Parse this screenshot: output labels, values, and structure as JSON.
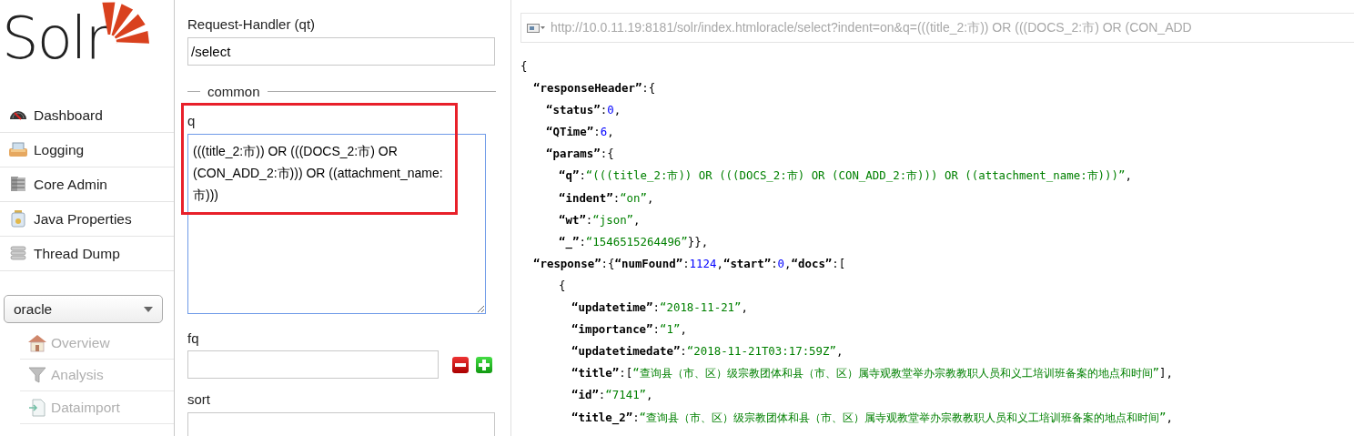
{
  "logo": {
    "text": "Solr"
  },
  "nav": [
    {
      "label": "Dashboard"
    },
    {
      "label": "Logging"
    },
    {
      "label": "Core Admin"
    },
    {
      "label": "Java Properties"
    },
    {
      "label": "Thread Dump"
    }
  ],
  "core_selector": {
    "value": "oracle"
  },
  "core_menu": [
    {
      "label": "Overview",
      "disabled": true
    },
    {
      "label": "Analysis",
      "disabled": true
    },
    {
      "label": "Dataimport",
      "disabled": true
    }
  ],
  "query_form": {
    "handler_label": "Request-Handler (qt)",
    "handler_value": "/select",
    "section": "common",
    "q_label": "q",
    "q_value": "(((title_2:市)) OR (((DOCS_2:市) OR (CON_ADD_2:市))) OR ((attachment_name:市)))",
    "q_focused": true,
    "fq_label": "fq",
    "sort_label": "sort"
  },
  "url_bar": {
    "text": "http://10.0.11.19:8181/solr/index.htmloracle/select?indent=on&q=(((title_2:市)) OR (((DOCS_2:市) OR (CON_ADD"
  },
  "response": [
    {
      "tokens": [
        {
          "kind": "punct",
          "text": "{"
        }
      ],
      "children": [
        {
          "tokens": [
            {
              "kind": "key",
              "text": "“responseHeader”"
            },
            {
              "kind": "punct",
              "text": ":{"
            }
          ],
          "children": [
            {
              "tokens": [
                {
                  "kind": "key",
                  "text": "“status”"
                },
                {
                  "kind": "punct",
                  "text": ":"
                },
                {
                  "kind": "num",
                  "text": "0"
                },
                {
                  "kind": "punct",
                  "text": ","
                }
              ]
            },
            {
              "tokens": [
                {
                  "kind": "key",
                  "text": "“QTime”"
                },
                {
                  "kind": "punct",
                  "text": ":"
                },
                {
                  "kind": "num",
                  "text": "6"
                },
                {
                  "kind": "punct",
                  "text": ","
                }
              ]
            },
            {
              "tokens": [
                {
                  "kind": "key",
                  "text": "“params”"
                },
                {
                  "kind": "punct",
                  "text": ":{"
                }
              ],
              "children": [
                {
                  "tokens": [
                    {
                      "kind": "key",
                      "text": "“q”"
                    },
                    {
                      "kind": "punct",
                      "text": ":"
                    },
                    {
                      "kind": "str",
                      "text": "“(((title_2:市)) OR (((DOCS_2:市) OR (CON_ADD_2:市))) OR ((attachment_name:市)))”"
                    },
                    {
                      "kind": "punct",
                      "text": ","
                    }
                  ]
                },
                {
                  "tokens": [
                    {
                      "kind": "key",
                      "text": "“indent”"
                    },
                    {
                      "kind": "punct",
                      "text": ":"
                    },
                    {
                      "kind": "str",
                      "text": "“on”"
                    },
                    {
                      "kind": "punct",
                      "text": ","
                    }
                  ]
                },
                {
                  "tokens": [
                    {
                      "kind": "key",
                      "text": "“wt”"
                    },
                    {
                      "kind": "punct",
                      "text": ":"
                    },
                    {
                      "kind": "str",
                      "text": "“json”"
                    },
                    {
                      "kind": "punct",
                      "text": ","
                    }
                  ]
                },
                {
                  "tokens": [
                    {
                      "kind": "key",
                      "text": "“_”"
                    },
                    {
                      "kind": "punct",
                      "text": ":"
                    },
                    {
                      "kind": "str",
                      "text": "“1546515264496”"
                    },
                    {
                      "kind": "punct",
                      "text": "}},"
                    }
                  ]
                }
              ]
            }
          ]
        },
        {
          "tokens": [
            {
              "kind": "key",
              "text": "“response”"
            },
            {
              "kind": "punct",
              "text": ":{"
            },
            {
              "kind": "key",
              "text": "“numFound”"
            },
            {
              "kind": "punct",
              "text": ":"
            },
            {
              "kind": "num",
              "text": "1124"
            },
            {
              "kind": "punct",
              "text": ","
            },
            {
              "kind": "key",
              "text": "“start”"
            },
            {
              "kind": "punct",
              "text": ":"
            },
            {
              "kind": "num",
              "text": "0"
            },
            {
              "kind": "punct",
              "text": ","
            },
            {
              "kind": "key",
              "text": "“docs”"
            },
            {
              "kind": "punct",
              "text": ":["
            }
          ],
          "children": [
            {
              "tokens": [
                {
                  "kind": "punct",
                  "text": "{"
                }
              ],
              "children": [
                {
                  "tokens": [
                    {
                      "kind": "key",
                      "text": "“updatetime”"
                    },
                    {
                      "kind": "punct",
                      "text": ":"
                    },
                    {
                      "kind": "str",
                      "text": "“2018-11-21”"
                    },
                    {
                      "kind": "punct",
                      "text": ","
                    }
                  ]
                },
                {
                  "tokens": [
                    {
                      "kind": "key",
                      "text": "“importance”"
                    },
                    {
                      "kind": "punct",
                      "text": ":"
                    },
                    {
                      "kind": "str",
                      "text": "“1”"
                    },
                    {
                      "kind": "punct",
                      "text": ","
                    }
                  ]
                },
                {
                  "tokens": [
                    {
                      "kind": "key",
                      "text": "“updatetimedate”"
                    },
                    {
                      "kind": "punct",
                      "text": ":"
                    },
                    {
                      "kind": "str",
                      "text": "“2018-11-21T03:17:59Z”"
                    },
                    {
                      "kind": "punct",
                      "text": ","
                    }
                  ]
                },
                {
                  "tokens": [
                    {
                      "kind": "key",
                      "text": "“title”"
                    },
                    {
                      "kind": "punct",
                      "text": ":["
                    },
                    {
                      "kind": "str",
                      "text": "“查询县（市、区）级宗教团体和县（市、区）属寺观教堂举办宗教教职人员和义工培训班备案的地点和时间”"
                    },
                    {
                      "kind": "punct",
                      "text": "],"
                    }
                  ]
                },
                {
                  "tokens": [
                    {
                      "kind": "key",
                      "text": "“id”"
                    },
                    {
                      "kind": "punct",
                      "text": ":"
                    },
                    {
                      "kind": "str",
                      "text": "“7141”"
                    },
                    {
                      "kind": "punct",
                      "text": ","
                    }
                  ]
                },
                {
                  "tokens": [
                    {
                      "kind": "key",
                      "text": "“title_2”"
                    },
                    {
                      "kind": "punct",
                      "text": ":"
                    },
                    {
                      "kind": "str",
                      "text": "“查询县（市、区）级宗教团体和县（市、区）属寺观教堂举办宗教教职人员和义工培训班备案的地点和时间”"
                    },
                    {
                      "kind": "punct",
                      "text": ","
                    }
                  ]
                }
              ]
            }
          ]
        }
      ]
    }
  ]
}
